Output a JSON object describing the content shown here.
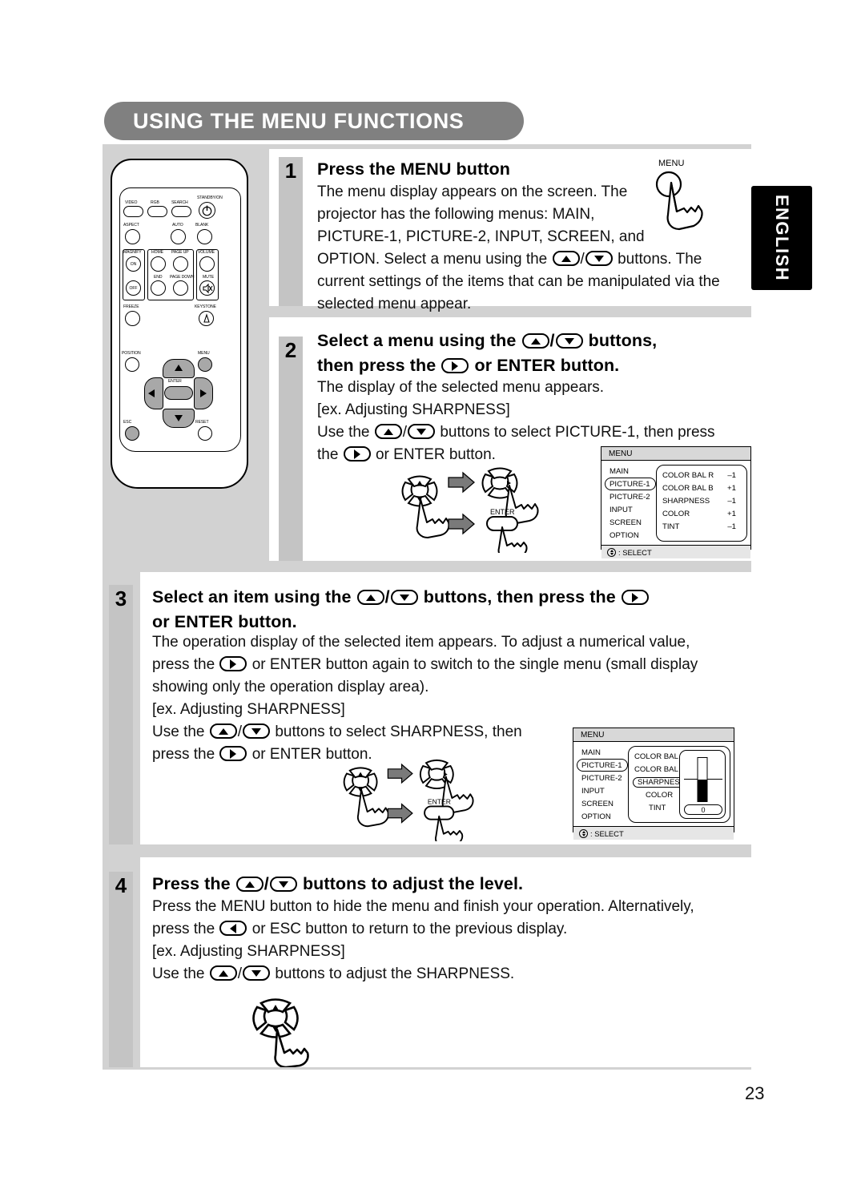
{
  "page": {
    "title": "USING THE MENU FUNCTIONS",
    "language_tab": "ENGLISH",
    "page_number": "23"
  },
  "remote": {
    "name": "projector-remote-control",
    "buttons": [
      {
        "label": "VIDEO"
      },
      {
        "label": "RGB"
      },
      {
        "label": "SEARCH"
      },
      {
        "label": "STANDBY/ON"
      },
      {
        "label": "ASPECT"
      },
      {
        "label": "AUTO"
      },
      {
        "label": "BLANK"
      },
      {
        "label": "MAGNIFY"
      },
      {
        "label": "ON"
      },
      {
        "label": "OFF"
      },
      {
        "label": "HOME"
      },
      {
        "label": "PAGE UP"
      },
      {
        "label": "END"
      },
      {
        "label": "PAGE DOWN"
      },
      {
        "label": "VOLUME"
      },
      {
        "label": "MUTE"
      },
      {
        "label": "FREEZE"
      },
      {
        "label": "KEYSTONE"
      },
      {
        "label": "POSITION"
      },
      {
        "label": "MENU"
      },
      {
        "label": "ENTER"
      },
      {
        "label": "ESC"
      },
      {
        "label": "RESET"
      }
    ],
    "labels": {
      "video": "VIDEO",
      "rgb": "RGB",
      "search": "SEARCH",
      "standby_on": "STANDBY/ON",
      "aspect": "ASPECT",
      "auto": "AUTO",
      "blank": "BLANK",
      "magnify": "MAGNIFY",
      "on": "ON",
      "off": "OFF",
      "home": "HOME",
      "page_up": "PAGE UP",
      "end": "END",
      "page_down": "PAGE DOWN",
      "volume": "VOLUME",
      "mute": "MUTE",
      "freeze": "FREEZE",
      "keystone": "KEYSTONE",
      "position": "POSITION",
      "menu": "MENU",
      "enter": "ENTER",
      "esc": "ESC",
      "reset": "RESET"
    }
  },
  "steps": [
    {
      "number": "1",
      "heading": "Press the MENU button",
      "body_lines": [
        "The menu display appears on the screen. The",
        "projector has the following menus: MAIN,",
        "PICTURE-1, PICTURE-2, INPUT, SCREEN, and",
        "OPTION. Select a menu using the ",
        "current settings of the items that can be manipulated via the",
        "selected menu appear."
      ],
      "fragments": {
        "l4a": "OPTION. Select a menu using the",
        "l4b": "buttons. The"
      },
      "illustration_label": "MENU"
    },
    {
      "number": "2",
      "heading_line1_a": "Select a menu using the",
      "heading_line1_b": "buttons,",
      "heading_line2_a": "then press the",
      "heading_line2_b": "or ENTER button.",
      "body_lines": [
        "The display of the selected menu appears.",
        "[ex. Adjusting SHARPNESS]"
      ],
      "frag_a": "Use the",
      "frag_b": "buttons to select PICTURE-1, then press",
      "frag_c": "the",
      "frag_d": "or ENTER button.",
      "illustration_enter_label": "ENTER"
    },
    {
      "number": "3",
      "heading_line1_a": "Select an item using the",
      "heading_line1_b": "buttons, then press the",
      "heading_line2": "or ENTER button.",
      "body_lines": [
        "The operation display of the selected item appears. To adjust a numerical value,",
        "showing only the operation display area).",
        "[ex. Adjusting SHARPNESS]"
      ],
      "frag_press_a": "press the",
      "frag_press_b": "or ENTER button again to switch to the single menu (small display",
      "frag_use_a": "Use the",
      "frag_use_b": "buttons to select SHARPNESS, then",
      "frag_press2_a": "press the",
      "frag_press2_b": "or ENTER button.",
      "illustration_enter_label": "ENTER"
    },
    {
      "number": "4",
      "heading_a": "Press the",
      "heading_b": "buttons to adjust the level.",
      "body_lines": [
        "Press the MENU button to hide the menu and finish your operation. Alternatively,",
        "[ex. Adjusting SHARPNESS]"
      ],
      "frag_press_a": "press the",
      "frag_press_b": "or ESC button to return to the previous display.",
      "frag_use_a": "Use the",
      "frag_use_b": "buttons to adjust the SHARPNESS."
    }
  ],
  "osd_menus": [
    {
      "id": "osd-step2",
      "title": "MENU",
      "left_items": [
        "MAIN",
        "PICTURE-1",
        "PICTURE-2",
        "INPUT",
        "SCREEN",
        "OPTION"
      ],
      "selected_left": "PICTURE-1",
      "rows": [
        {
          "label": "COLOR BAL R",
          "value": "–1"
        },
        {
          "label": "COLOR BAL B",
          "value": "+1"
        },
        {
          "label": "SHARPNESS",
          "value": "–1"
        },
        {
          "label": "COLOR",
          "value": "+1"
        },
        {
          "label": "TINT",
          "value": "–1"
        }
      ],
      "footer": ": SELECT"
    },
    {
      "id": "osd-step3",
      "title": "MENU",
      "left_items": [
        "MAIN",
        "PICTURE-1",
        "PICTURE-2",
        "INPUT",
        "SCREEN",
        "OPTION"
      ],
      "selected_left": "PICTURE-1",
      "rows": [
        {
          "label": "COLOR BAL R",
          "value": ""
        },
        {
          "label": "COLOR BAL B",
          "value": ""
        },
        {
          "label": "SHARPNESS",
          "value": ""
        },
        {
          "label": "COLOR",
          "value": ""
        },
        {
          "label": "TINT",
          "value": ""
        }
      ],
      "selected_row": "SHARPNESS",
      "gauge_value": "0",
      "footer": ": SELECT"
    }
  ]
}
